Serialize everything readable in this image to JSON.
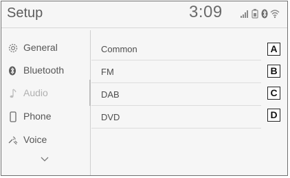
{
  "header": {
    "title": "Setup",
    "time": "3:09"
  },
  "sidebar": {
    "items": [
      {
        "label": "General",
        "icon": "gear-icon"
      },
      {
        "label": "Bluetooth",
        "icon": "bluetooth-icon"
      },
      {
        "label": "Audio",
        "icon": "music-note-icon",
        "state": "selected"
      },
      {
        "label": "Phone",
        "icon": "phone-icon"
      },
      {
        "label": "Voice",
        "icon": "voice-icon"
      }
    ],
    "more_icon": "chevron-down-icon"
  },
  "menu": {
    "rows": [
      {
        "label": "Common",
        "callout": "A"
      },
      {
        "label": "FM",
        "callout": "B"
      },
      {
        "label": "DAB",
        "callout": "C"
      },
      {
        "label": "DVD",
        "callout": "D"
      }
    ]
  },
  "status_icons": [
    "signal-icon",
    "battery-icon",
    "bluetooth-icon",
    "wifi-icon"
  ],
  "colors": {
    "background": "#f6f6f6",
    "text": "#555555",
    "dim_text": "#b0b0b0",
    "border": "#6f6f6f"
  }
}
